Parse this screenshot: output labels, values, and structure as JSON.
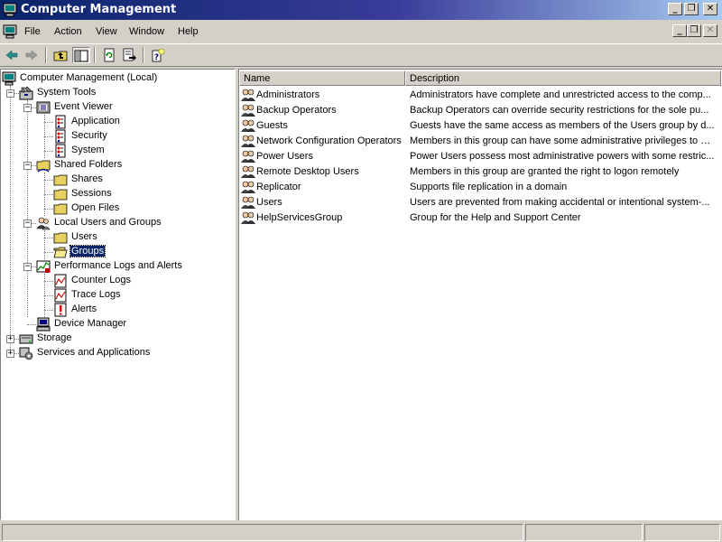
{
  "window": {
    "title": "Computer Management",
    "app_icon": "computer-management-icon"
  },
  "menu": {
    "items": [
      {
        "label": "File"
      },
      {
        "label": "Action"
      },
      {
        "label": "View"
      },
      {
        "label": "Window"
      },
      {
        "label": "Help"
      }
    ]
  },
  "toolbar": {
    "buttons": [
      "back-arrow-icon",
      "forward-arrow-icon",
      "up-one-level-icon",
      "show-hide-tree-icon",
      "refresh-icon",
      "export-list-icon",
      "help-icon"
    ]
  },
  "tree": {
    "items": [
      {
        "label": "Computer Management (Local)",
        "icon": "computer-icon"
      },
      {
        "label": "System Tools",
        "icon": "toolbox-icon"
      },
      {
        "label": "Event Viewer",
        "icon": "event-viewer-icon"
      },
      {
        "label": "Application",
        "icon": "log-icon"
      },
      {
        "label": "Security",
        "icon": "log-icon"
      },
      {
        "label": "System",
        "icon": "log-icon"
      },
      {
        "label": "Shared Folders",
        "icon": "shared-folder-icon"
      },
      {
        "label": "Shares",
        "icon": "folder-icon"
      },
      {
        "label": "Sessions",
        "icon": "folder-icon"
      },
      {
        "label": "Open Files",
        "icon": "folder-icon"
      },
      {
        "label": "Local Users and Groups",
        "icon": "users-groups-icon"
      },
      {
        "label": "Users",
        "icon": "folder-icon"
      },
      {
        "label": "Groups",
        "icon": "open-folder-icon",
        "selected": true
      },
      {
        "label": "Performance Logs and Alerts",
        "icon": "performance-icon"
      },
      {
        "label": "Counter Logs",
        "icon": "chart-log-icon"
      },
      {
        "label": "Trace Logs",
        "icon": "chart-log-icon"
      },
      {
        "label": "Alerts",
        "icon": "alert-icon"
      },
      {
        "label": "Device Manager",
        "icon": "device-manager-icon"
      },
      {
        "label": "Storage",
        "icon": "storage-icon"
      },
      {
        "label": "Services and Applications",
        "icon": "services-icon"
      }
    ]
  },
  "list": {
    "columns": [
      "Name",
      "Description"
    ],
    "rows": [
      {
        "name": "Administrators",
        "description": "Administrators have complete and unrestricted access to the comp..."
      },
      {
        "name": "Backup Operators",
        "description": "Backup Operators can override security restrictions for the sole pu..."
      },
      {
        "name": "Guests",
        "description": "Guests have the same access as members of the Users group by d..."
      },
      {
        "name": "Network Configuration Operators",
        "description": "Members in this group can have some administrative privileges to m..."
      },
      {
        "name": "Power Users",
        "description": "Power Users possess most administrative powers with some restric..."
      },
      {
        "name": "Remote Desktop Users",
        "description": "Members in this group are granted the right to logon remotely"
      },
      {
        "name": "Replicator",
        "description": "Supports file replication in a domain"
      },
      {
        "name": "Users",
        "description": "Users are prevented from making accidental or intentional system-..."
      },
      {
        "name": "HelpServicesGroup",
        "description": "Group for the Help and Support Center"
      }
    ]
  },
  "colors": {
    "title_bar_start": "#0a246a",
    "title_bar_end": "#a6caf0",
    "selection": "#0a246a",
    "chrome": "#d4d0c8"
  }
}
